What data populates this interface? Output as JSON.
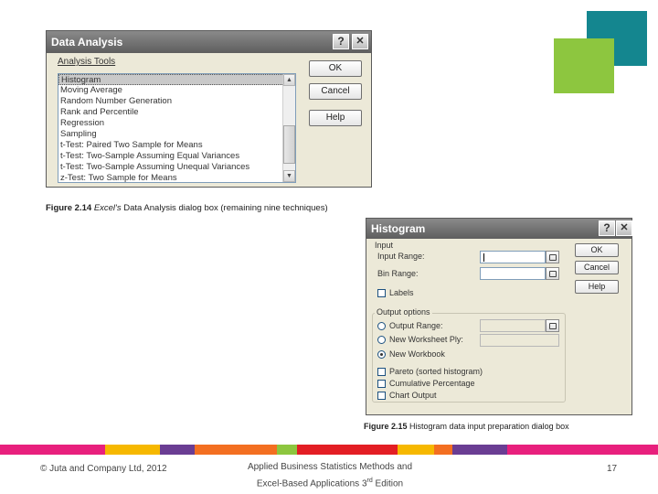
{
  "data_analysis": {
    "title": "Data Analysis",
    "help_glyph": "?",
    "close_glyph": "✕",
    "list_label": "Analysis Tools",
    "tools": [
      "Histogram",
      "Moving Average",
      "Random Number Generation",
      "Rank and Percentile",
      "Regression",
      "Sampling",
      "t-Test: Paired Two Sample for Means",
      "t-Test: Two-Sample Assuming Equal Variances",
      "t-Test: Two-Sample Assuming Unequal Variances",
      "z-Test: Two Sample for Means"
    ],
    "selected": "Histogram",
    "ok": "OK",
    "cancel": "Cancel",
    "help": "Help"
  },
  "caption_214": {
    "label": "Figure 2.14",
    "italic": "Excel's",
    "text": "Data Analysis dialog box (remaining nine techniques)"
  },
  "histogram": {
    "title": "Histogram",
    "help_glyph": "?",
    "close_glyph": "✕",
    "input_group": "Input",
    "input_range": "Input Range:",
    "bin_range": "Bin Range:",
    "labels": "Labels",
    "output_group": "Output options",
    "output_range": "Output Range:",
    "new_worksheet": "New Worksheet Ply:",
    "new_workbook": "New Workbook",
    "pareto": "Pareto (sorted histogram)",
    "cumulative": "Cumulative Percentage",
    "chart_output": "Chart Output",
    "ok": "OK",
    "cancel": "Cancel",
    "help": "Help"
  },
  "caption_215": {
    "label": "Figure 2.15",
    "text": "Histogram data input preparation dialog box"
  },
  "footer": {
    "copyright": "© Juta and Company Ltd, 2012",
    "book_line1": "Applied Business Statistics Methods and",
    "book_line2": "Excel-Based Applications 3",
    "book_sup": "rd",
    "book_edition": " Edition",
    "page_number": "17"
  },
  "stripe_colors": [
    "#e8207d",
    "#f6b800",
    "#6a3d93",
    "#f36f21",
    "#8dc63f",
    "#e31e24",
    "#f6b800",
    "#f36f21",
    "#6a3d93",
    "#e8207d"
  ]
}
